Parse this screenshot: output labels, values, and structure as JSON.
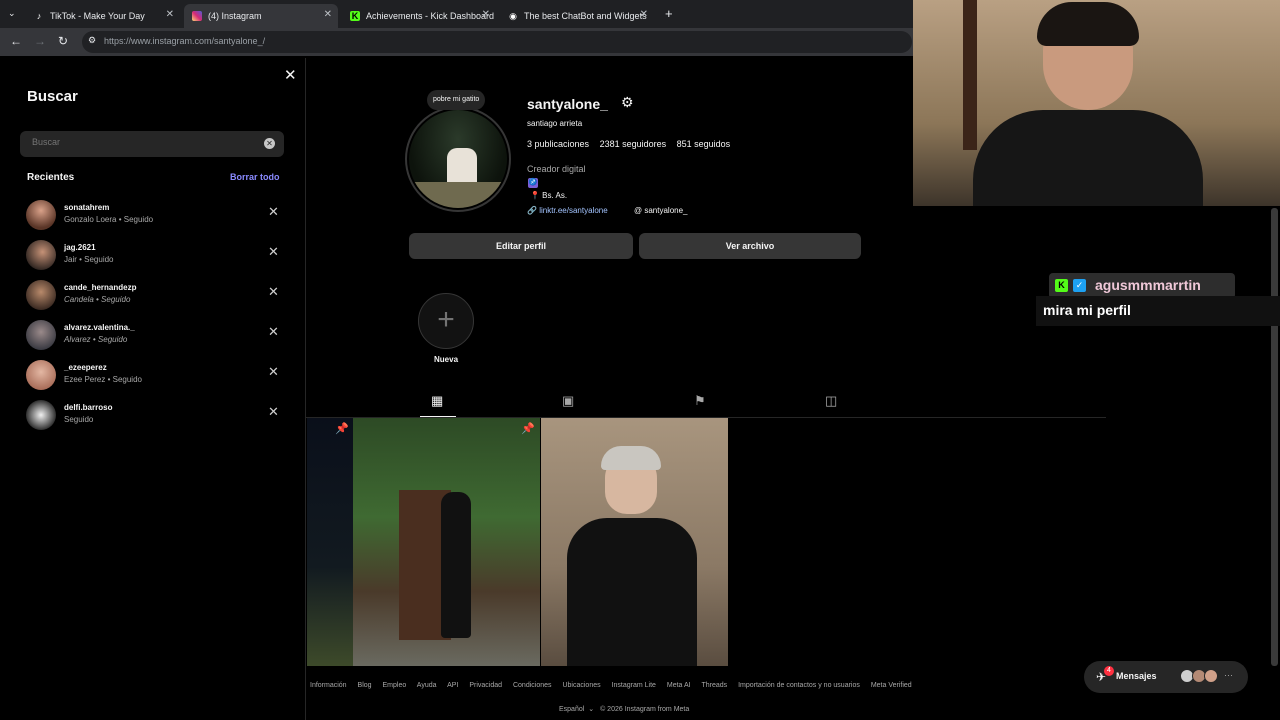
{
  "browser": {
    "tabs": [
      {
        "label": "TikTok - Make Your Day",
        "icon": "tiktok-icon"
      },
      {
        "label": "(4) Instagram",
        "icon": "instagram-icon"
      },
      {
        "label": "Achievements - Kick Dashboard",
        "icon": "kick-icon"
      },
      {
        "label": "The best ChatBot and Widgets",
        "icon": "bot-icon"
      }
    ],
    "url": "https://www.instagram.com/santyalone_/"
  },
  "search_panel": {
    "title": "Buscar",
    "placeholder": "Buscar",
    "recent_title": "Recientes",
    "clear_all": "Borrar todo",
    "items": [
      {
        "username": "sonatahrem",
        "sub": "Gonzalo Loera • Seguido"
      },
      {
        "username": "jag.2621",
        "sub": "Jair • Seguido"
      },
      {
        "username": "cande_hernandezp",
        "sub": "Candela • Seguido"
      },
      {
        "username": "alvarez.valentina._",
        "sub": "Alvarez • Seguido"
      },
      {
        "username": "_ezeeperez",
        "sub": "Ezee Perez • Seguido"
      },
      {
        "username": "delfi.barroso",
        "sub": "Seguido"
      }
    ]
  },
  "profile": {
    "note": "pobre mi gatito",
    "username": "santyalone_",
    "full_name": "santiago arrieta",
    "posts": "3 publicaciones",
    "followers": "2381 seguidores",
    "following": "851 seguidos",
    "category": "Creador digital",
    "location": "📍 Bs. As.",
    "link": "linktr.ee/santyalone",
    "threads": "santyalone_",
    "edit_button": "Editar perfil",
    "archive_button": "Ver archivo",
    "new_highlight": "Nueva"
  },
  "footer": {
    "links": [
      "Información",
      "Blog",
      "Empleo",
      "Ayuda",
      "API",
      "Privacidad",
      "Condiciones",
      "Ubicaciones",
      "Instagram Lite",
      "Meta AI",
      "Threads",
      "Importación de contactos y no usuarios",
      "Meta Verified"
    ],
    "language": "Español",
    "copyright": "© 2026 Instagram from Meta"
  },
  "messages": {
    "label": "Mensajes",
    "badge": "4"
  },
  "stream_chat": {
    "user": "agusmmmarrtin",
    "message": "mira mi perfil"
  }
}
